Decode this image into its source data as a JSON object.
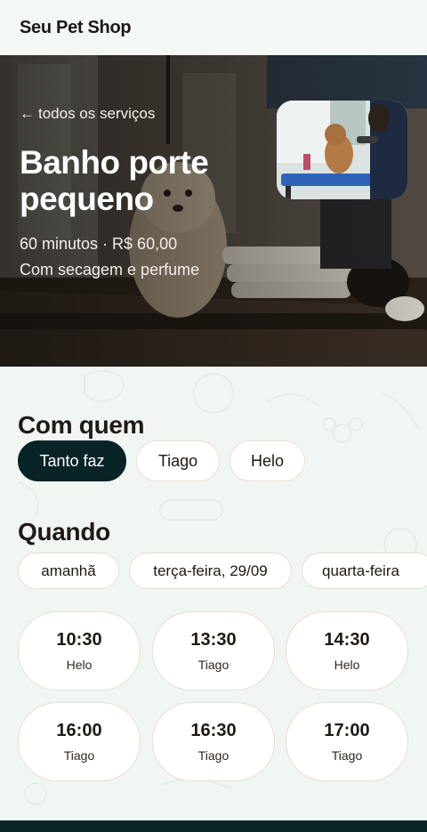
{
  "app": {
    "brand": "Seu Pet Shop"
  },
  "hero": {
    "back_label": "todos os serviços",
    "title": "Banho porte pequeno",
    "meta": "60 minutos · R$ 60,00",
    "description": "Com secagem e perfume"
  },
  "who": {
    "title": "Com quem",
    "options": [
      {
        "label": "Tanto faz",
        "selected": true
      },
      {
        "label": "Tiago",
        "selected": false
      },
      {
        "label": "Helo",
        "selected": false
      }
    ]
  },
  "when": {
    "title": "Quando",
    "dates": [
      "amanhã",
      "terça-feira, 29/09",
      "quarta-feira"
    ],
    "slots": [
      {
        "time": "10:30",
        "who": "Helo"
      },
      {
        "time": "13:30",
        "who": "Tiago"
      },
      {
        "time": "14:30",
        "who": "Helo"
      },
      {
        "time": "16:00",
        "who": "Tiago"
      },
      {
        "time": "16:30",
        "who": "Tiago"
      },
      {
        "time": "17:00",
        "who": "Tiago"
      }
    ]
  },
  "colors": {
    "accent": "#082427",
    "background": "#f1f6f3"
  }
}
